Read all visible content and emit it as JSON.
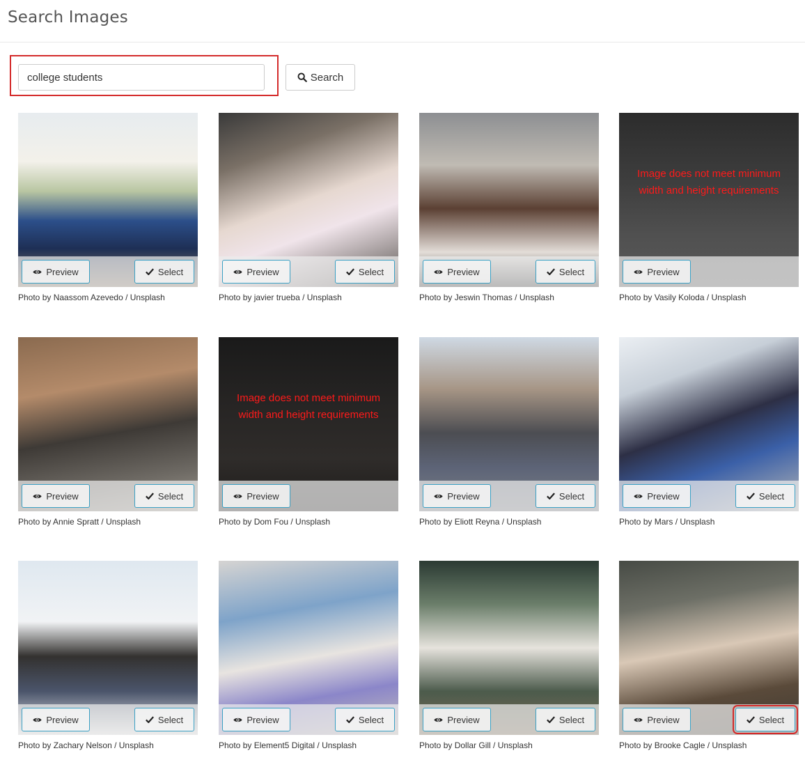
{
  "page_title": "Search Images",
  "search": {
    "value": "college students",
    "button_label": "Search"
  },
  "labels": {
    "preview": "Preview",
    "select": "Select"
  },
  "results": [
    {
      "credit": "Photo by Naassom Azevedo / Unsplash",
      "warning": "",
      "selectable": true
    },
    {
      "credit": "Photo by javier trueba / Unsplash",
      "warning": "",
      "selectable": true
    },
    {
      "credit": "Photo by Jeswin Thomas / Unsplash",
      "warning": "",
      "selectable": true
    },
    {
      "credit": "Photo by Vasily Koloda / Unsplash",
      "warning": "Image does not meet minimum width and height requirements",
      "selectable": false
    },
    {
      "credit": "Photo by Annie Spratt / Unsplash",
      "warning": "",
      "selectable": true
    },
    {
      "credit": "Photo by Dom Fou / Unsplash",
      "warning": "Image does not meet minimum width and height requirements",
      "selectable": false
    },
    {
      "credit": "Photo by Eliott Reyna / Unsplash",
      "warning": "",
      "selectable": true
    },
    {
      "credit": "Photo by Mars / Unsplash",
      "warning": "",
      "selectable": true
    },
    {
      "credit": "Photo by Zachary Nelson / Unsplash",
      "warning": "",
      "selectable": true
    },
    {
      "credit": "Photo by Element5 Digital / Unsplash",
      "warning": "",
      "selectable": true
    },
    {
      "credit": "Photo by Dollar Gill / Unsplash",
      "warning": "",
      "selectable": true
    },
    {
      "credit": "Photo by Brooke Cagle / Unsplash",
      "warning": "",
      "selectable": true
    }
  ],
  "colors": {
    "highlight": "#d42a2a",
    "button_border": "#3aa0c4",
    "warning_text": "#ff1a1a"
  }
}
